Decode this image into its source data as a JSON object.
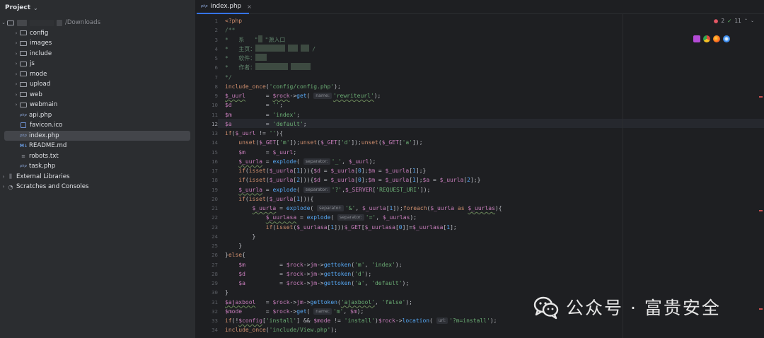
{
  "project": {
    "header": "Project",
    "root_path": "/Downloads",
    "items": [
      {
        "label": "config",
        "kind": "folder"
      },
      {
        "label": "images",
        "kind": "folder"
      },
      {
        "label": "include",
        "kind": "folder"
      },
      {
        "label": "js",
        "kind": "folder"
      },
      {
        "label": "mode",
        "kind": "folder"
      },
      {
        "label": "upload",
        "kind": "folder"
      },
      {
        "label": "web",
        "kind": "folder"
      },
      {
        "label": "webmain",
        "kind": "folder"
      },
      {
        "label": "api.php",
        "kind": "php"
      },
      {
        "label": "favicon.ico",
        "kind": "ico"
      },
      {
        "label": "index.php",
        "kind": "php",
        "selected": true
      },
      {
        "label": "README.md",
        "kind": "md"
      },
      {
        "label": "robots.txt",
        "kind": "txt"
      },
      {
        "label": "task.php",
        "kind": "php"
      }
    ],
    "external_libraries": "External Libraries",
    "scratches": "Scratches and Consoles"
  },
  "editor": {
    "tab_label": "index.php",
    "tab_icon": "php",
    "errors_count": "2",
    "checks_count": "11",
    "current_line": 12,
    "line_numbers": [
      "1",
      "2",
      "3",
      "4",
      "5",
      "6",
      "7",
      "8",
      "9",
      "10",
      "11",
      "12",
      "13",
      "14",
      "15",
      "16",
      "17",
      "18",
      "19",
      "20",
      "21",
      "22",
      "23",
      "24",
      "25",
      "26",
      "27",
      "28",
      "29",
      "30",
      "31",
      "32",
      "33",
      "34"
    ],
    "hints": {
      "name": "name:",
      "separator": "separator:",
      "url": "url:"
    },
    "code": {
      "l1": "<?php",
      "l2": "/**",
      "l3a": "*   系   \"",
      "l3b": "\"源入口",
      "l4": "*   主页：",
      "l5": "*   软件：",
      "l6": "*   作者：",
      "l7": "*/",
      "l8": "include_once('config/config.php');"
    }
  },
  "watermark": {
    "text": "公众号 · 富贵安全"
  },
  "colors": {
    "background": "#1e1f22",
    "panel": "#2b2d30",
    "keyword": "#cf8e6d",
    "variable": "#c77dbb",
    "string": "#6aab73",
    "function": "#56a8f5",
    "error": "#e55765",
    "ok": "#5fb865"
  }
}
